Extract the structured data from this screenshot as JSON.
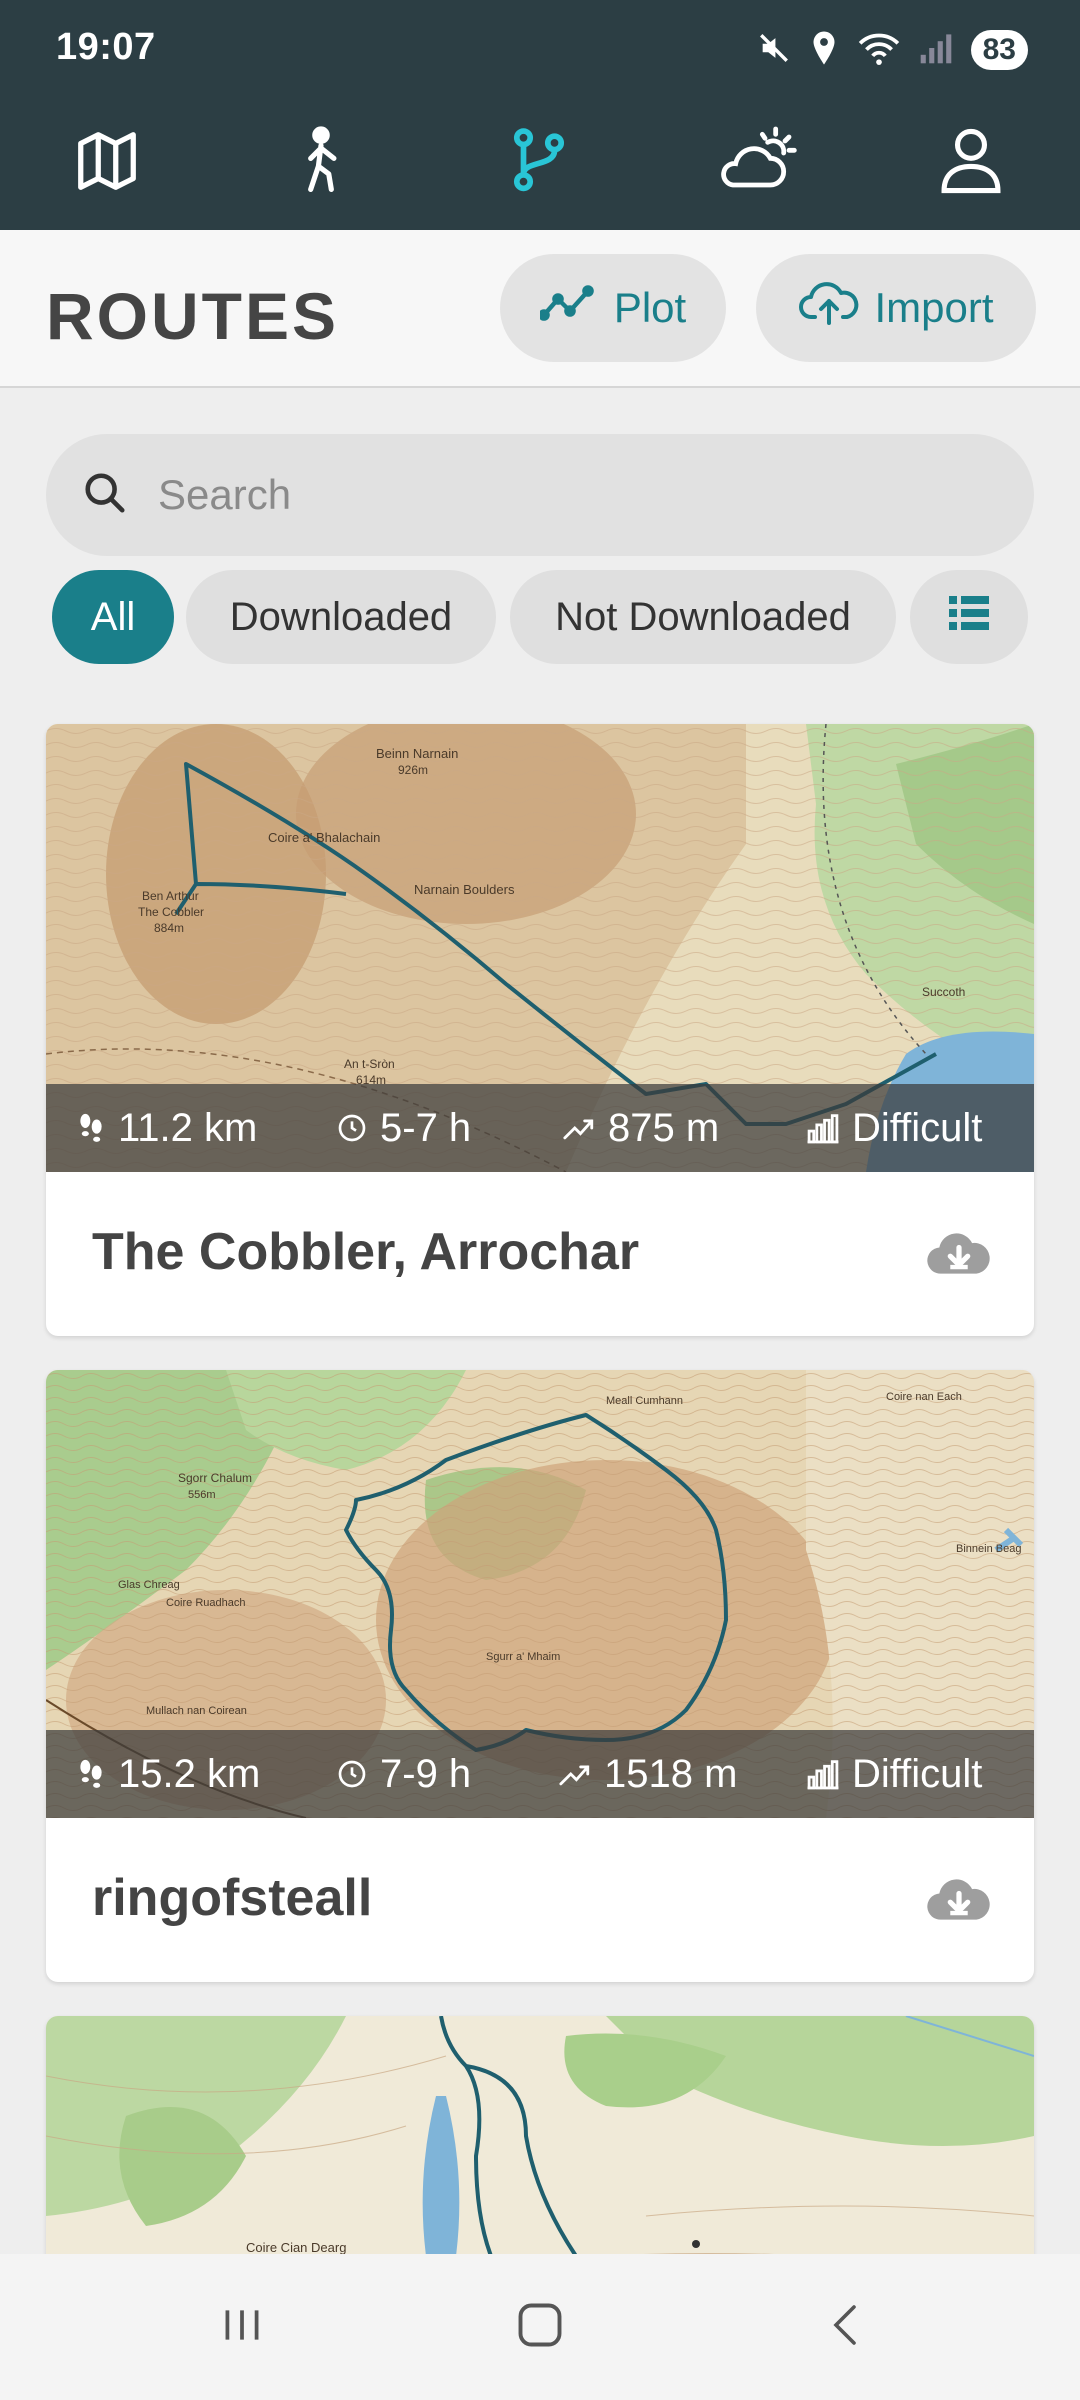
{
  "status_bar": {
    "time": "19:07",
    "battery": "83",
    "icons": [
      "mute-icon",
      "location-icon",
      "wifi-icon",
      "signal-icon"
    ]
  },
  "top_nav": {
    "items": [
      {
        "name": "map-icon",
        "active": false
      },
      {
        "name": "hiker-icon",
        "active": false
      },
      {
        "name": "routes-icon",
        "active": true
      },
      {
        "name": "weather-icon",
        "active": false
      },
      {
        "name": "profile-icon",
        "active": false
      }
    ],
    "active_color": "#29c5d6"
  },
  "header": {
    "title": "ROUTES",
    "plot_label": "Plot",
    "import_label": "Import"
  },
  "search": {
    "placeholder": "Search",
    "value": ""
  },
  "filters": {
    "chips": [
      "All",
      "Downloaded",
      "Not Downloaded"
    ],
    "active": "All",
    "list_view_icon": "list-icon"
  },
  "routes": [
    {
      "name": "The Cobbler, Arrochar",
      "distance": "11.2 km",
      "duration": "5-7 h",
      "ascent": "875 m",
      "difficulty": "Difficult",
      "map_labels": [
        "Beinn Narnain",
        "926m",
        "Coire a' Bhalachain",
        "Narnain Boulders",
        "Ben Arthur",
        "The Cobbler",
        "884m",
        "An t-Sròn",
        "614m",
        "Succoth"
      ]
    },
    {
      "name": "ringofsteall",
      "distance": "15.2 km",
      "duration": "7-9 h",
      "ascent": "1518 m",
      "difficulty": "Difficult",
      "map_labels": [
        "Sgorr Chalum",
        "556m",
        "Glas Chreag",
        "Coire Ruadhach",
        "Sgurr a' Mhaim",
        "Mullach nan Coirean",
        "Binnein Beag",
        "Coire nan Each",
        "Meall Cumhann"
      ]
    },
    {
      "name": "",
      "map_labels": [
        "Coire Cian Dearg"
      ]
    }
  ],
  "colors": {
    "header_bg": "#2c3e44",
    "accent": "#1a7f8a",
    "route_line": "#1f5f6e"
  },
  "system_nav": [
    "recents-icon",
    "home-icon",
    "back-icon"
  ]
}
